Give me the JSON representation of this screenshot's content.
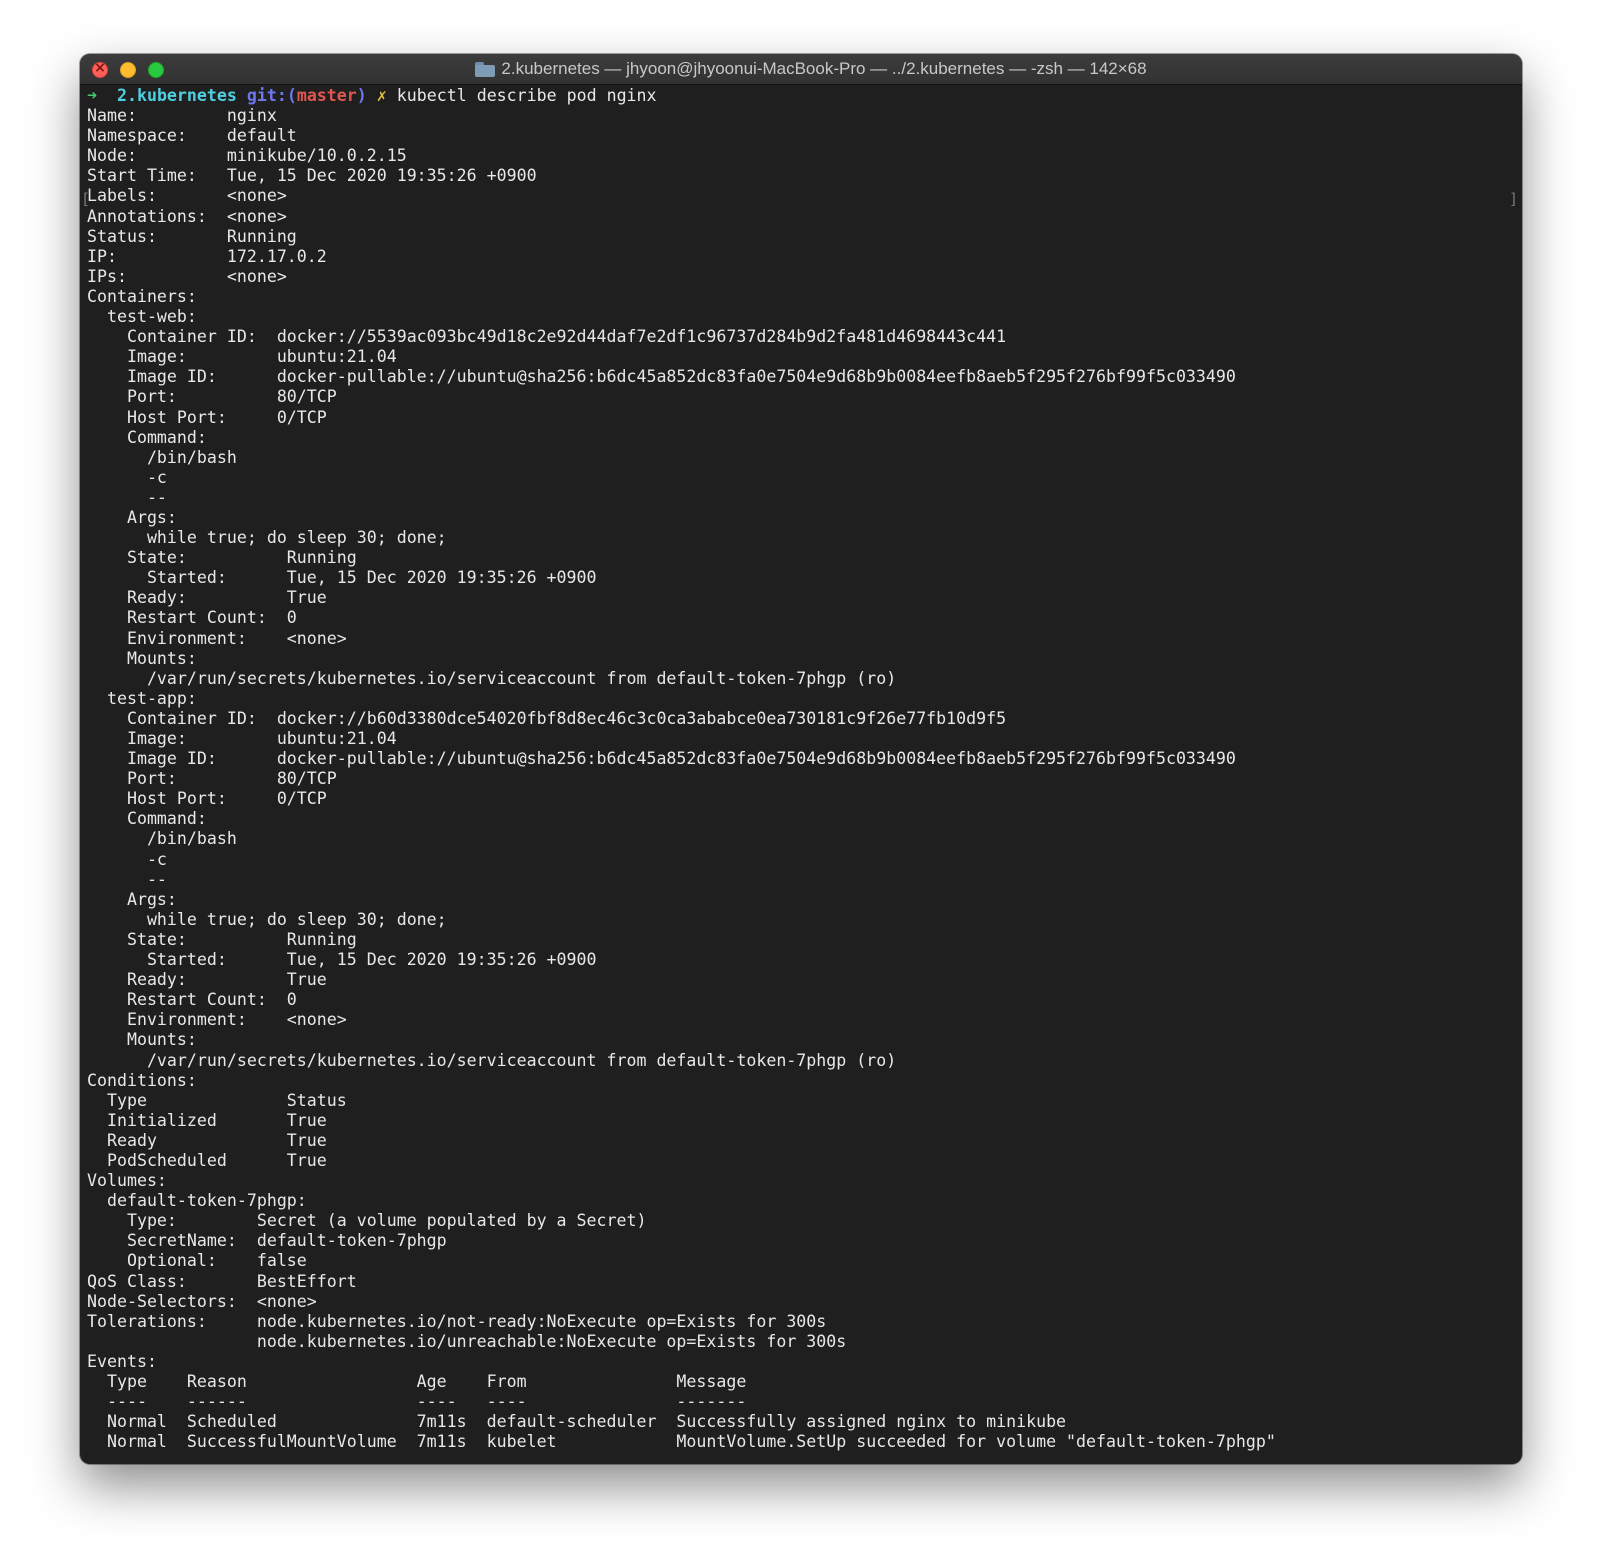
{
  "window": {
    "title": "2.kubernetes — jhyoon@jhyoonui-MacBook-Pro — ../2.kubernetes — -zsh — 142×68",
    "folder_icon": "folder-icon"
  },
  "prompt": {
    "arrow": "➜",
    "dir": "2.kubernetes",
    "git_label": "git:(",
    "branch": "master",
    "git_close": ")",
    "dirty_mark": "✗",
    "command": "kubectl describe pod nginx"
  },
  "side_marks": {
    "left": "[",
    "right": "]"
  },
  "output": [
    "Name:         nginx",
    "Namespace:    default",
    "Node:         minikube/10.0.2.15",
    "Start Time:   Tue, 15 Dec 2020 19:35:26 +0900",
    "Labels:       <none>",
    "Annotations:  <none>",
    "Status:       Running",
    "IP:           172.17.0.2",
    "IPs:          <none>",
    "Containers:",
    "  test-web:",
    "    Container ID:  docker://5539ac093bc49d18c2e92d44daf7e2df1c96737d284b9d2fa481d4698443c441",
    "    Image:         ubuntu:21.04",
    "    Image ID:      docker-pullable://ubuntu@sha256:b6dc45a852dc83fa0e7504e9d68b9b0084eefb8aeb5f295f276bf99f5c033490",
    "    Port:          80/TCP",
    "    Host Port:     0/TCP",
    "    Command:",
    "      /bin/bash",
    "      -c",
    "      --",
    "    Args:",
    "      while true; do sleep 30; done;",
    "    State:          Running",
    "      Started:      Tue, 15 Dec 2020 19:35:26 +0900",
    "    Ready:          True",
    "    Restart Count:  0",
    "    Environment:    <none>",
    "    Mounts:",
    "      /var/run/secrets/kubernetes.io/serviceaccount from default-token-7phgp (ro)",
    "  test-app:",
    "    Container ID:  docker://b60d3380dce54020fbf8d8ec46c3c0ca3ababce0ea730181c9f26e77fb10d9f5",
    "    Image:         ubuntu:21.04",
    "    Image ID:      docker-pullable://ubuntu@sha256:b6dc45a852dc83fa0e7504e9d68b9b0084eefb8aeb5f295f276bf99f5c033490",
    "    Port:          80/TCP",
    "    Host Port:     0/TCP",
    "    Command:",
    "      /bin/bash",
    "      -c",
    "      --",
    "    Args:",
    "      while true; do sleep 30; done;",
    "    State:          Running",
    "      Started:      Tue, 15 Dec 2020 19:35:26 +0900",
    "    Ready:          True",
    "    Restart Count:  0",
    "    Environment:    <none>",
    "    Mounts:",
    "      /var/run/secrets/kubernetes.io/serviceaccount from default-token-7phgp (ro)",
    "Conditions:",
    "  Type              Status",
    "  Initialized       True",
    "  Ready             True",
    "  PodScheduled      True",
    "Volumes:",
    "  default-token-7phgp:",
    "    Type:        Secret (a volume populated by a Secret)",
    "    SecretName:  default-token-7phgp",
    "    Optional:    false",
    "QoS Class:       BestEffort",
    "Node-Selectors:  <none>",
    "Tolerations:     node.kubernetes.io/not-ready:NoExecute op=Exists for 300s",
    "                 node.kubernetes.io/unreachable:NoExecute op=Exists for 300s",
    "Events:",
    "  Type    Reason                 Age    From               Message",
    "  ----    ------                 ----   ----               -------",
    "  Normal  Scheduled              7m11s  default-scheduler  Successfully assigned nginx to minikube",
    "  Normal  SuccessfulMountVolume  7m11s  kubelet            MountVolume.SetUp succeeded for volume \"default-token-7phgp\""
  ]
}
